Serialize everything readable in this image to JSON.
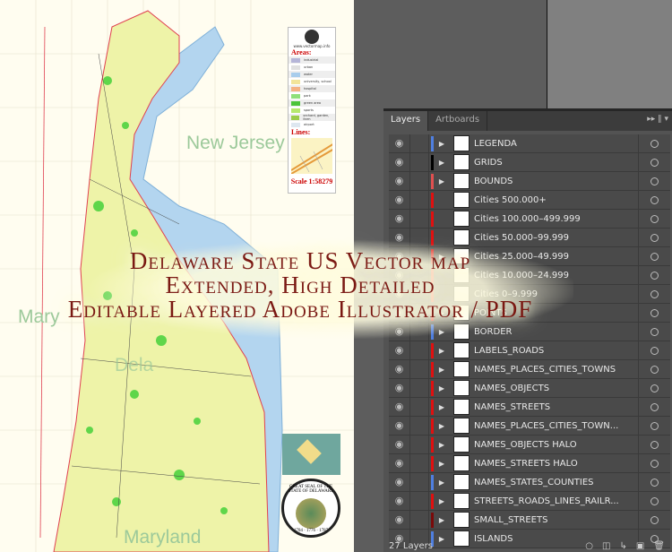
{
  "map": {
    "labels": {
      "new_jersey": "New Jersey",
      "maryland_partial": "Mary",
      "delaware_partial": "Dela",
      "maryland": "Maryland"
    },
    "legend": {
      "site": "www.vectormap.info",
      "areas_title": "Areas:",
      "areas": [
        {
          "label": "industrial",
          "color": "#b5b5d8"
        },
        {
          "label": "urban",
          "color": "#e0e0e0"
        },
        {
          "label": "water",
          "color": "#a8cdec"
        },
        {
          "label": "university, school",
          "color": "#f2e49a"
        },
        {
          "label": "hospital",
          "color": "#f4b183"
        },
        {
          "label": "park",
          "color": "#8fe07a"
        },
        {
          "label": "green area",
          "color": "#4cc43a"
        },
        {
          "label": "sports",
          "color": "#b6e86e"
        },
        {
          "label": "orchard, garden, farm",
          "color": "#9ccc4a"
        },
        {
          "label": "airport",
          "color": "#dde7f0"
        }
      ],
      "lines_title": "Lines:",
      "scale": "Scale 1:58279"
    },
    "seal_text": "GREAT SEAL OF THE STATE OF DELAWARE",
    "seal_years": "1704 · 1776 · 1787"
  },
  "overlay": {
    "line1": "Delaware State US Vector map",
    "line2": "Extended, High Detailed",
    "line3": "Editable Layered Adobe Illustrator / PDF"
  },
  "panel": {
    "tabs": [
      {
        "label": "Layers",
        "active": true
      },
      {
        "label": "Artboards",
        "active": false
      }
    ],
    "menu_icon": "double-chevron-right",
    "layers": [
      {
        "name": "LEGENDA",
        "color": "#4f7fe0",
        "expandable": true
      },
      {
        "name": "GRIDS",
        "color": "#000000",
        "expandable": true
      },
      {
        "name": "BOUNDS",
        "color": "#e05050",
        "expandable": true
      },
      {
        "name": "Cities 500.000+",
        "color": "#e01010",
        "expandable": false
      },
      {
        "name": "Cities 100.000–499.999",
        "color": "#e01010",
        "expandable": false
      },
      {
        "name": "Cities 50.000–99.999",
        "color": "#e01010",
        "expandable": false
      },
      {
        "name": "Cities 25.000–49.999",
        "color": "#e01010",
        "expandable": true
      },
      {
        "name": "Cities 10.000–24.999",
        "color": "#e01010",
        "expandable": false
      },
      {
        "name": "Cities 0–9.999",
        "color": "#e01010",
        "expandable": false
      },
      {
        "name": "POINTS",
        "color": "#e01010",
        "expandable": true
      },
      {
        "name": "BORDER",
        "color": "#4f7fe0",
        "expandable": true
      },
      {
        "name": "LABELS_ROADS",
        "color": "#e01010",
        "expandable": true
      },
      {
        "name": "NAMES_PLACES_CITIES_TOWNS",
        "color": "#e01010",
        "expandable": true
      },
      {
        "name": "NAMES_OBJECTS",
        "color": "#e01010",
        "expandable": true
      },
      {
        "name": "NAMES_STREETS",
        "color": "#e01010",
        "expandable": true
      },
      {
        "name": "NAMES_PLACES_CITIES_TOWN...",
        "color": "#e01010",
        "expandable": true
      },
      {
        "name": "NAMES_OBJECTS HALO",
        "color": "#e01010",
        "expandable": true
      },
      {
        "name": "NAMES_STREETS HALO",
        "color": "#e01010",
        "expandable": true
      },
      {
        "name": "NAMES_STATES_COUNTIES",
        "color": "#4f7fe0",
        "expandable": true
      },
      {
        "name": "STREETS_ROADS_LINES_RAILR...",
        "color": "#e01010",
        "expandable": true
      },
      {
        "name": "SMALL_STREETS",
        "color": "#7a0a0a",
        "expandable": true
      },
      {
        "name": "ISLANDS",
        "color": "#4f7fe0",
        "expandable": true
      }
    ],
    "footer": {
      "count": "27 Layers"
    }
  }
}
